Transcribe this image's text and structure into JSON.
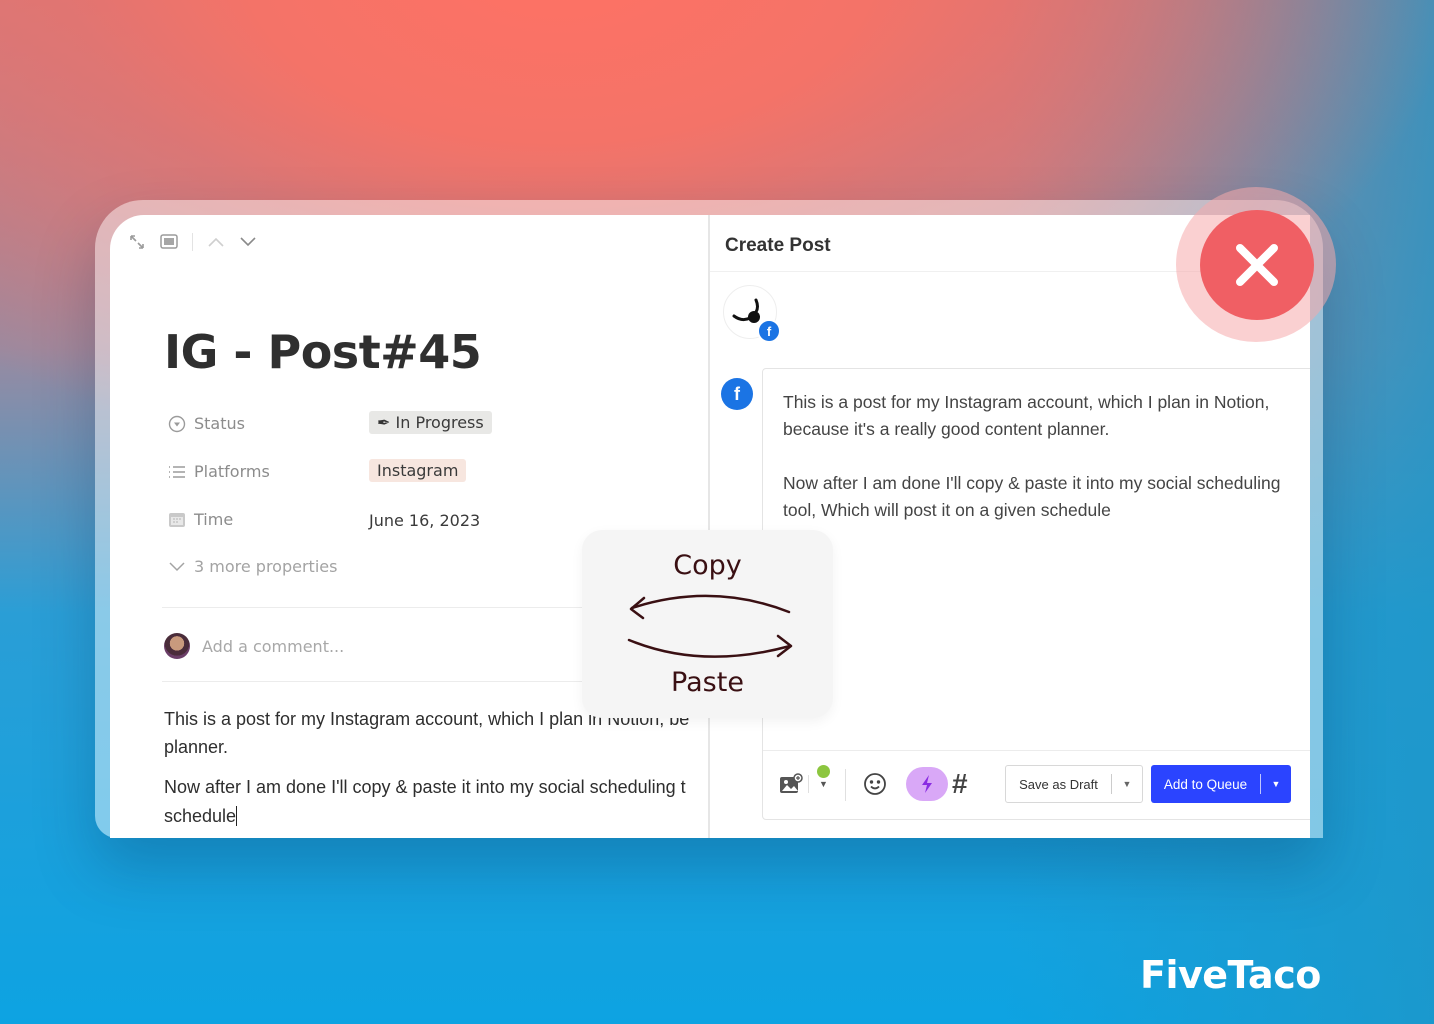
{
  "notion": {
    "toolbar_icons": [
      "expand-icon",
      "side-peek-icon",
      "chevron-up-icon",
      "chevron-down-icon"
    ],
    "page_title": "IG - Post#45",
    "properties": [
      {
        "icon": "status-icon",
        "label": "Status",
        "value": "In Progress",
        "value_icon": "pen-icon"
      },
      {
        "icon": "list-icon",
        "label": "Platforms",
        "value": "Instagram"
      },
      {
        "icon": "calendar-icon",
        "label": "Time",
        "value": "June 16, 2023"
      }
    ],
    "more_properties": "3 more properties",
    "comment_placeholder": "Add a comment...",
    "body": {
      "line1": "This is a post for my Instagram account, which I plan in Notion, be",
      "line2": "planner.",
      "line3": "Now after I am done I'll copy & paste it into my social scheduling t",
      "line4": "schedule"
    }
  },
  "create_post": {
    "title": "Create Post",
    "network": "facebook",
    "post_text": "This is a post for my Instagram account, which I plan in Notion,\nbecause it's a really good content planner.\n\nNow after I am done I'll copy & paste it into my social scheduling\ntool, Which will post it on a given schedule",
    "toolbar_icons": [
      "add-media-icon",
      "status-dot-icon",
      "emoji-icon",
      "ai-assistant-icon",
      "hashtag-icon"
    ],
    "save_draft_label": "Save as Draft",
    "add_queue_label": "Add to Queue",
    "status_dot_color": "#8cc63f",
    "queue_color": "#2b44ff",
    "ai_button_color": "#d9a8f7"
  },
  "overlay": {
    "copy_label": "Copy",
    "paste_label": "Paste"
  },
  "close_button": {
    "color": "#f05f64"
  },
  "brand": "FiveTaco"
}
